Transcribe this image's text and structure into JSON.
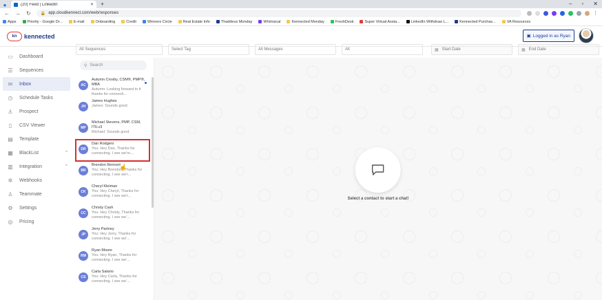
{
  "browser": {
    "tab_title": "(20) Feed | LinkedIn",
    "url": "app.cloudkennect.com/web/responses",
    "bookmarks": [
      "Apps",
      "Priority - Google Dr...",
      "E-mail",
      "Onboarding",
      "Credit",
      "Winners Circle",
      "Real Estate Info",
      "Thaddeus Monday",
      "Whimsical",
      "Kennected Monday",
      "FreshDesk",
      "Super Virtual Assta...",
      "LinkedIn Withdraw L...",
      "Kennected Purchas...",
      "VA Resources"
    ],
    "bookmark_colors": [
      "#4285f4",
      "#34a853",
      "#f2c94c",
      "#f2c94c",
      "#f2c94c",
      "#3b82f6",
      "#f2c94c",
      "#1e3a8a",
      "#7c3aed",
      "#f2c94c",
      "#22c55e",
      "#e53935",
      "#111111",
      "#1e3a8a",
      "#f2c94c"
    ]
  },
  "header": {
    "logo_text": "kennected",
    "logo_mark": "kn",
    "logged_in": "Logged in as Ryan"
  },
  "sidebar": {
    "items": [
      {
        "label": "Dashboard",
        "icon": "monitor-icon",
        "glyph": "▭"
      },
      {
        "label": "Sequences",
        "icon": "list-icon",
        "glyph": "☰"
      },
      {
        "label": "Inbox",
        "icon": "inbox-icon",
        "glyph": "✉",
        "active": true
      },
      {
        "label": "Schedule Tasks",
        "icon": "clock-icon",
        "glyph": "◷"
      },
      {
        "label": "Prospect",
        "icon": "user-icon",
        "glyph": "♙"
      },
      {
        "label": "CSV Viewer",
        "icon": "file-icon",
        "glyph": "▯"
      },
      {
        "label": "Template",
        "icon": "template-icon",
        "glyph": "▤"
      },
      {
        "label": "BlackList",
        "icon": "blacklist-icon",
        "glyph": "▦",
        "caret": true
      },
      {
        "label": "Integration",
        "icon": "integration-icon",
        "glyph": "▥",
        "caret": true
      },
      {
        "label": "Webhooks",
        "icon": "webhook-icon",
        "glyph": "✲"
      },
      {
        "label": "Teammate",
        "icon": "teammate-icon",
        "glyph": "♙"
      },
      {
        "label": "Settings",
        "icon": "gear-icon",
        "glyph": "⚙"
      },
      {
        "label": "Pricing",
        "icon": "pricing-icon",
        "glyph": "◎"
      }
    ]
  },
  "filters": {
    "sequences": "All Sequences",
    "tag": "Select Tag",
    "messages": "All Messages",
    "all": "All",
    "start_date": "Start Date",
    "end_date": "End Date"
  },
  "contacts": {
    "search_placeholder": "Search",
    "list": [
      {
        "initials": "AC",
        "name": "Autumn Crosby, CSM®, PMP®,  MBA",
        "msg": "Autumn: Looking forward to it thanks for connecti...",
        "unread": true
      },
      {
        "initials": "JH",
        "name": "James Hughes",
        "msg": "James: Sounds good"
      },
      {
        "initials": "MP",
        "name": "Michael Stevens, PMP, CSM, ITILv3",
        "msg": "Michael: Sounds good"
      },
      {
        "initials": "DR",
        "name": "Dan Rodgers",
        "msg": "You: Hey Dan, Thanks for connecting. I see we're...",
        "highlighted": true
      },
      {
        "initials": "BR",
        "name": "Brendon Rennert",
        "msg": "You: Hey Brendon, Thanks for connecting. I see we'r..."
      },
      {
        "initials": "CK",
        "name": "Cheryl Kleiman",
        "msg": "You: Hey Cheryl, Thanks for connecting. I see we'r..."
      },
      {
        "initials": "CC",
        "name": "Christy Cash",
        "msg": "You: Hey Christy, Thanks for connecting. I see we'..."
      },
      {
        "initials": "JP",
        "name": "Jerry Partney",
        "msg": "You: Hey Jerry, Thanks for connecting. I see we'..."
      },
      {
        "initials": "RM",
        "name": "Ryan Moore",
        "msg": "You: Hey Ryan, Thanks for connecting. I see we'..."
      },
      {
        "initials": "CS",
        "name": "Carla Salario",
        "msg": "You: Hey Carla, Thanks for connecting. I see we'..."
      }
    ]
  },
  "chat": {
    "empty_prompt": "Select a contact to start a chat!"
  },
  "colors": {
    "accent": "#1e3a8a",
    "avatar": "#6b7fd7",
    "highlight": "#d32f2f"
  }
}
